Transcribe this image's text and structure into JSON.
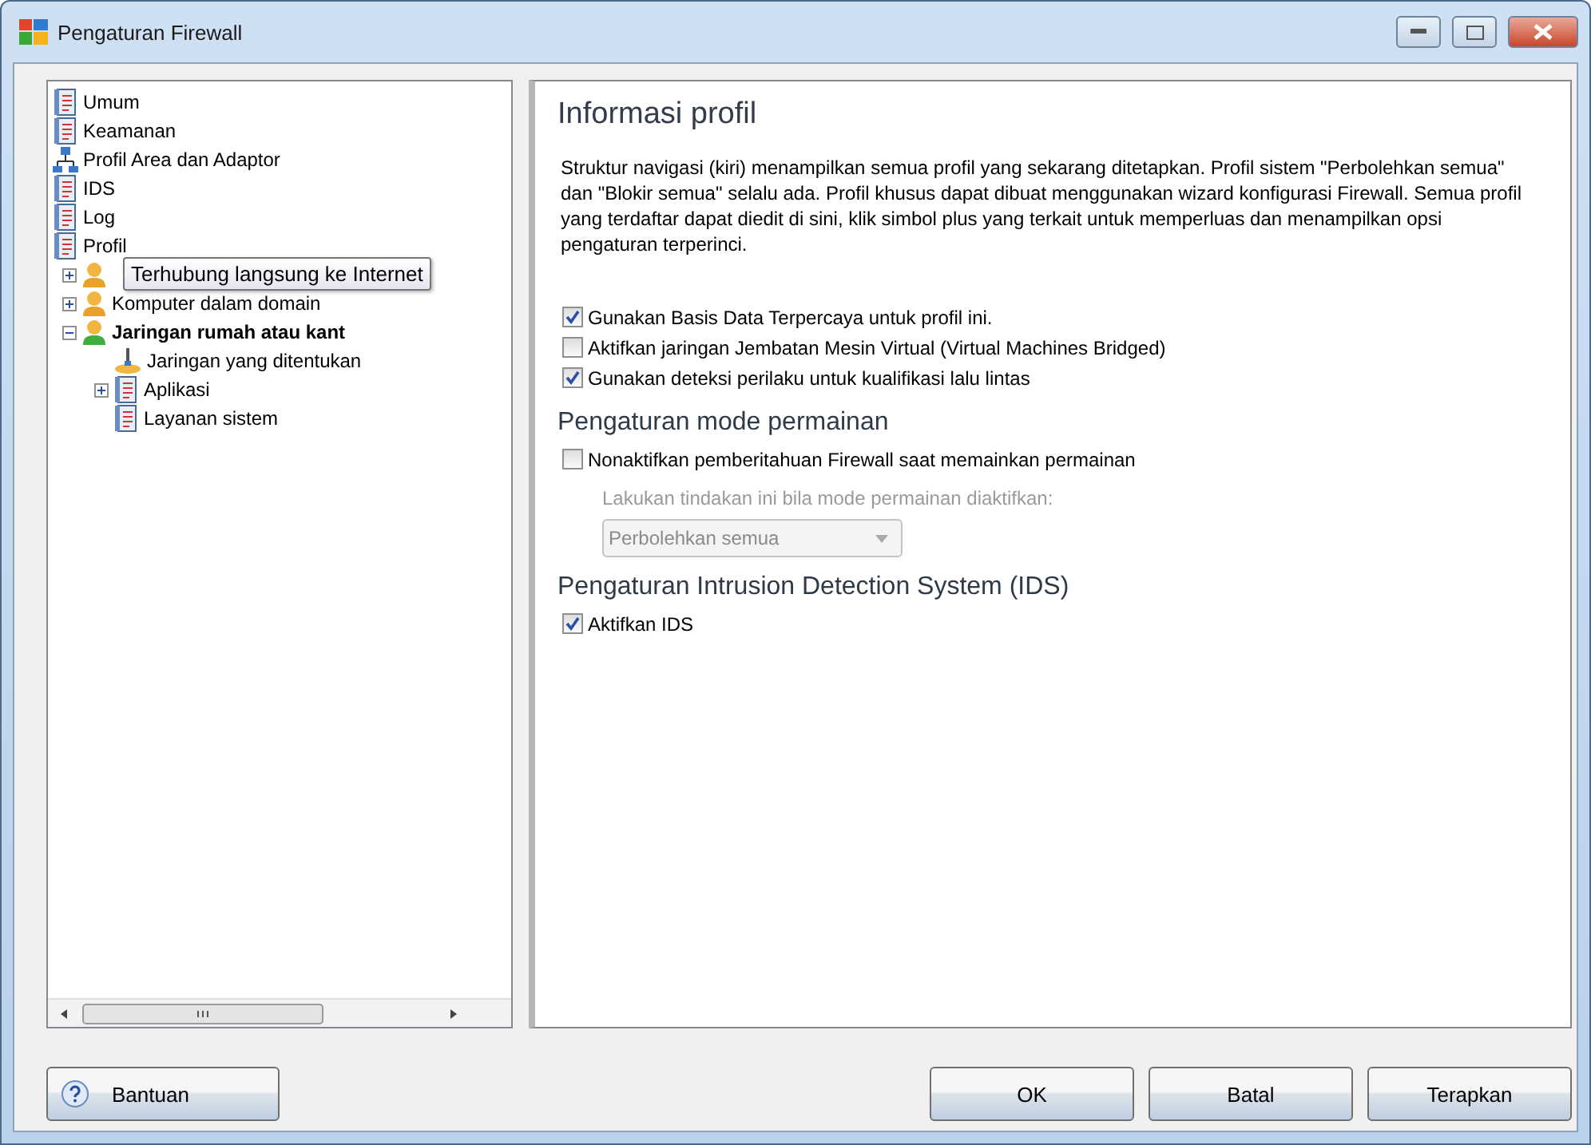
{
  "window": {
    "title": "Pengaturan Firewall"
  },
  "tree": [
    {
      "label": "Umum",
      "kind": "document"
    },
    {
      "label": "Keamanan",
      "kind": "document"
    },
    {
      "label": "Profil Area dan Adaptor",
      "kind": "network"
    },
    {
      "label": "IDS",
      "kind": "document"
    },
    {
      "label": "Log",
      "kind": "document"
    },
    {
      "label": "Profil",
      "kind": "document",
      "children": [
        {
          "label": "Terhubung langsung ke Internet",
          "kind": "user",
          "color": "#e8a22a",
          "expanded": false,
          "selected": false,
          "tooltip": true
        },
        {
          "label": "Komputer dalam domain",
          "kind": "user",
          "color": "#e8a22a",
          "expanded": false,
          "selected": false
        },
        {
          "label": "Jaringan rumah atau kant",
          "kind": "user",
          "color": "#3fae3f",
          "expanded": true,
          "selected": true,
          "children": [
            {
              "label": "Jaringan yang ditentukan",
              "kind": "pin"
            },
            {
              "label": "Aplikasi",
              "kind": "document",
              "expanded": false
            },
            {
              "label": "Layanan sistem",
              "kind": "document"
            }
          ]
        }
      ]
    }
  ],
  "panel": {
    "title": "Informasi profil",
    "description": "Struktur navigasi (kiri) menampilkan semua profil yang sekarang ditetapkan. Profil sistem \"Perbolehkan semua\" dan \"Blokir semua\" selalu ada. Profil khusus dapat dibuat menggunakan wizard konfigurasi Firewall. Semua profil yang terdaftar dapat diedit di sini, klik simbol plus yang terkait untuk memperluas dan menampilkan opsi pengaturan terperinci.",
    "options": [
      {
        "label": "Gunakan Basis Data Terpercaya untuk profil ini.",
        "checked": true
      },
      {
        "label": "Aktifkan jaringan Jembatan Mesin Virtual (Virtual Machines Bridged)",
        "checked": false
      },
      {
        "label": "Gunakan deteksi perilaku untuk kualifikasi lalu lintas",
        "checked": true
      }
    ],
    "game_mode": {
      "title": "Pengaturan mode permainan",
      "option": {
        "label": "Nonaktifkan pemberitahuan Firewall saat memainkan permainan",
        "checked": false
      },
      "action_label": "Lakukan tindakan ini bila mode permainan diaktifkan:",
      "action_value": "Perbolehkan semua",
      "disabled": true
    },
    "ids": {
      "title": "Pengaturan Intrusion Detection System (IDS)",
      "option": {
        "label": "Aktifkan IDS",
        "checked": true
      }
    }
  },
  "buttons": {
    "help": "Bantuan",
    "actions": [
      "OK",
      "Batal",
      "Terapkan"
    ]
  }
}
